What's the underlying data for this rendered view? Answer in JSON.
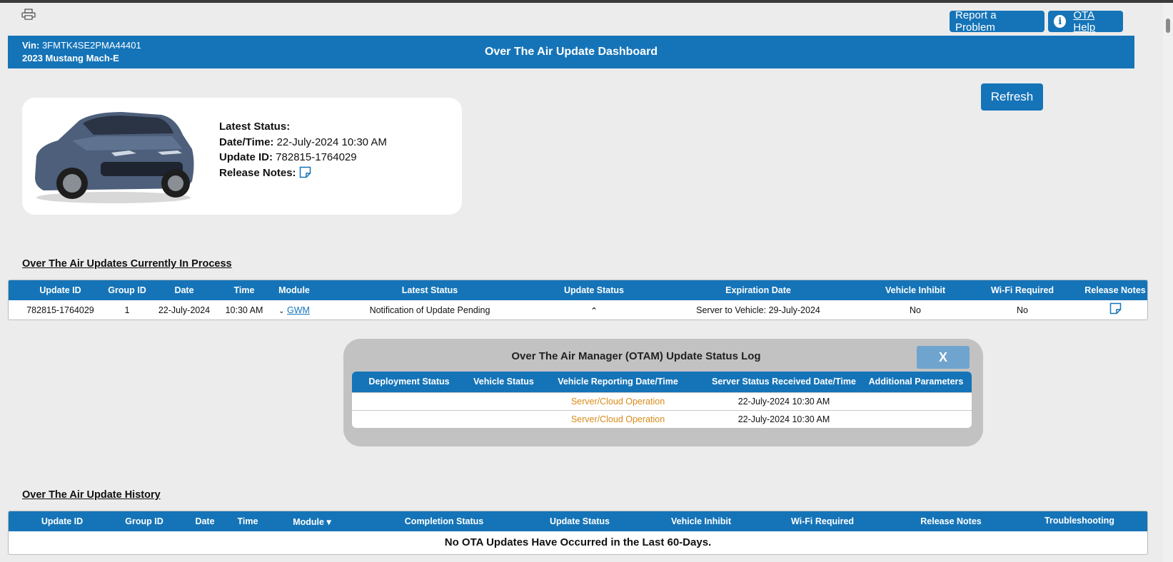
{
  "header": {
    "vin_label": "Vin:",
    "vin_value": "3FMTK4SE2PMA44401",
    "vehicle": "2023 Mustang Mach-E",
    "title": "Over The Air Update Dashboard",
    "report_button": "Report a Problem",
    "help_button": "OTA Help",
    "refresh_button": "Refresh"
  },
  "status_card": {
    "latest_status_label": "Latest Status:",
    "datetime_label": "Date/Time:",
    "datetime_value": "22-July-2024 10:30 AM",
    "update_id_label": "Update ID:",
    "update_id_value": "782815-1764029",
    "release_notes_label": "Release Notes:"
  },
  "in_process": {
    "title": "Over The Air Updates Currently In Process",
    "columns": [
      "Update ID",
      "Group ID",
      "Date",
      "Time",
      "Module",
      "Latest Status",
      "Update Status",
      "Expiration Date",
      "Vehicle Inhibit",
      "Wi-Fi Required",
      "Release Notes"
    ],
    "row": {
      "update_id": "782815-1764029",
      "group_id": "1",
      "date": "22-July-2024",
      "time": "10:30 AM",
      "module": "GWM",
      "latest_status": "Notification of Update Pending",
      "expiration": "Server to Vehicle: 29-July-2024",
      "vehicle_inhibit": "No",
      "wifi_required": "No"
    }
  },
  "log": {
    "title": "Over The Air Manager (OTAM) Update Status Log",
    "close_label": "X",
    "columns": [
      "Deployment Status",
      "Vehicle Status",
      "Vehicle Reporting Date/Time",
      "Server Status Received Date/Time",
      "Additional Parameters"
    ],
    "rows": [
      {
        "reporting": "Server/Cloud Operation",
        "received": "22-July-2024 10:30 AM"
      },
      {
        "reporting": "Server/Cloud Operation",
        "received": "22-July-2024 10:30 AM"
      }
    ]
  },
  "history": {
    "title": "Over The Air Update History",
    "columns": [
      "Update ID",
      "Group ID",
      "Date",
      "Time",
      "Module",
      "Completion Status",
      "Update Status",
      "Vehicle Inhibit",
      "Wi-Fi Required",
      "Release Notes",
      "Troubleshooting"
    ],
    "empty_message": "No OTA Updates Have Occurred in the Last 60-Days."
  },
  "colors": {
    "primary": "#1574b8",
    "background": "#ececec",
    "accent_orange": "#d98a1a"
  },
  "icons": [
    "printer-icon",
    "info-icon",
    "release-notes-icon",
    "chevron-down-icon",
    "chevron-up-icon",
    "sort-down-icon"
  ]
}
